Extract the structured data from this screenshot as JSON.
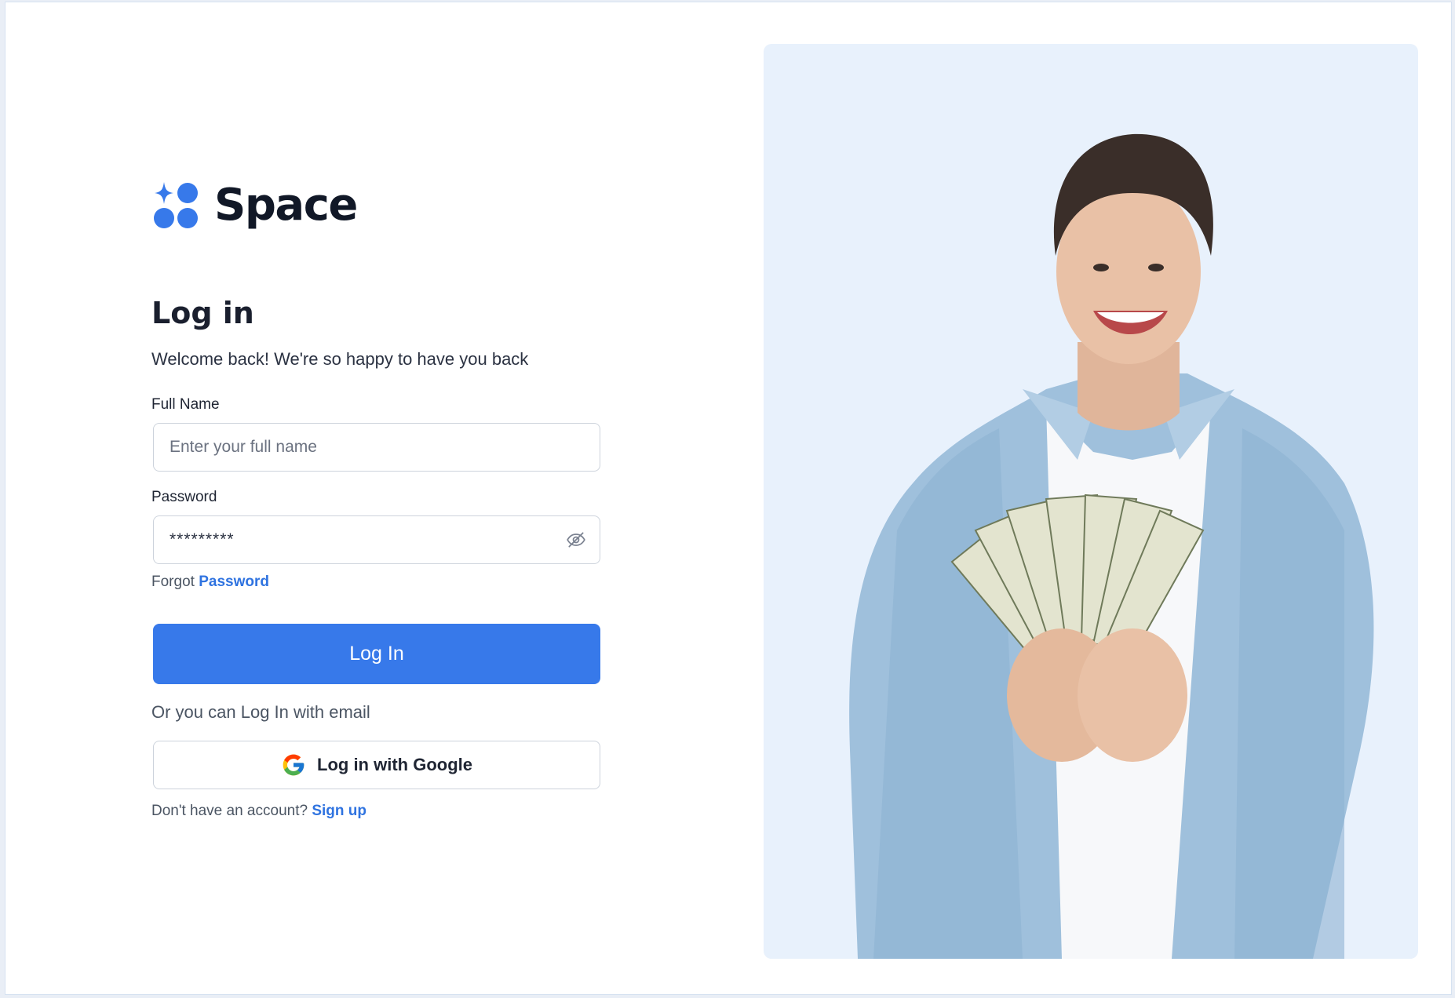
{
  "brand": {
    "name": "Space",
    "accent_color": "#3779ea"
  },
  "login": {
    "heading": "Log in",
    "subtitle": "Welcome back! We're so happy to have you back",
    "full_name": {
      "label": "Full Name",
      "placeholder": "Enter your full name",
      "value": ""
    },
    "password": {
      "label": "Password",
      "value": "*********",
      "toggle_icon": "eye-off-icon"
    },
    "forgot": {
      "prefix": "Forgot",
      "link": "Password"
    },
    "submit_label": "Log In",
    "alt_text": "Or you can Log In with email",
    "google_label": "Log in with Google",
    "signup": {
      "prefix": "Don't have an account?",
      "link": "Sign up"
    }
  },
  "hero": {
    "background": "#e8f1fc",
    "image_subject": "smiling man in denim shirt holding fan of dollar bills"
  }
}
